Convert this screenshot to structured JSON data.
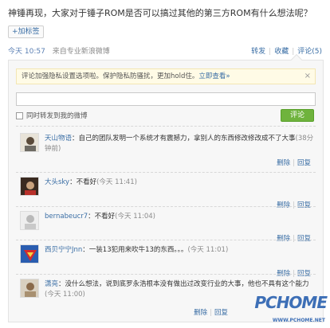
{
  "post": {
    "text": "神锤再现，大家对于锤子ROM是否可以搞过其他的第三方ROM有什么想法呢？",
    "tag_button": "+加标签",
    "time": "今天 10:57",
    "source": "来自专业新浪微博",
    "actions": {
      "forward": "转发",
      "favorite": "收藏",
      "comment": "评论(5)"
    }
  },
  "comment_panel": {
    "notice": "评论加强隐私设置选项啦。保护隐私防骚扰，更加hold住。",
    "notice_link": "立即查看»",
    "notice_close": "×",
    "forward_checkbox_label": "同时转发到我的微博",
    "submit_label": "评论"
  },
  "comments": [
    {
      "user": "天山物语",
      "text": "：自己的团队发明一个系统才有震撼力，拿别人的东西修改修改成不了大事",
      "time": "(38分钟前)",
      "delete": "删除",
      "reply": "回复"
    },
    {
      "user": "大头sky",
      "text": "：不看好",
      "time": "(今天 11:41)",
      "delete": "删除",
      "reply": "回复"
    },
    {
      "user": "bernabeucr7",
      "text": "：不看好",
      "time": "(今天 11:04)",
      "delete": "删除",
      "reply": "回复"
    },
    {
      "user": "西贝宁宁Jnn",
      "text": "：一装13犯用来吹牛13的东西。。。",
      "time": "(今天 11:01)",
      "delete": "删除",
      "reply": "回复"
    },
    {
      "user": "潇亮",
      "text": "：没什么想法，说到底罗永浩根本没有做出过改变行业的大事，他也不具有这个能力",
      "time": "(今天 11:00)",
      "delete": "删除",
      "reply": "回复"
    }
  ],
  "watermark": {
    "text": "PCHOME",
    "url": "WWW.PCHOME.NET"
  },
  "colors": {
    "link": "#3a6ea5",
    "submit": "#6fb33d",
    "notice_bg": "#fffbe6"
  }
}
